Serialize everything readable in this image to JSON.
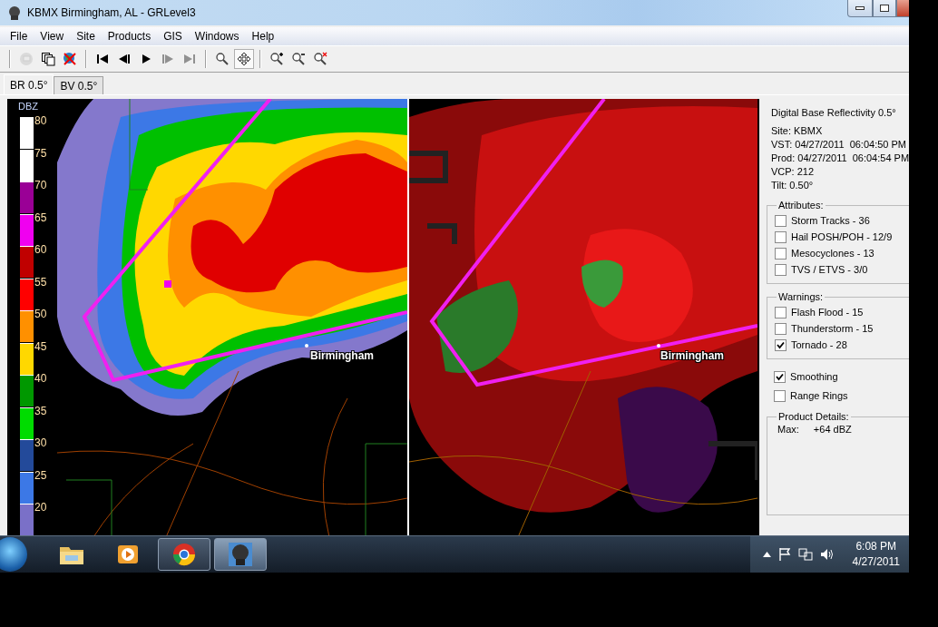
{
  "window": {
    "title": "KBMX Birmingham, AL - GRLevel3"
  },
  "menu": [
    "File",
    "View",
    "Site",
    "Products",
    "GIS",
    "Windows",
    "Help"
  ],
  "toolbar": [
    [
      {
        "kind": "site",
        "disabled": true,
        "selected": false
      },
      {
        "kind": "windows",
        "disabled": false,
        "selected": false
      },
      {
        "kind": "disconnect",
        "disabled": false,
        "selected": false
      }
    ],
    [
      {
        "kind": "first",
        "disabled": false,
        "selected": false
      },
      {
        "kind": "previous",
        "disabled": false,
        "selected": false
      },
      {
        "kind": "play",
        "disabled": false,
        "selected": false
      },
      {
        "kind": "next",
        "disabled": true,
        "selected": false
      },
      {
        "kind": "last",
        "disabled": true,
        "selected": false
      }
    ],
    [
      {
        "kind": "zoom",
        "disabled": false,
        "selected": false
      },
      {
        "kind": "pan",
        "disabled": false,
        "selected": true
      }
    ],
    [
      {
        "kind": "zoom-in",
        "disabled": false,
        "selected": false
      },
      {
        "kind": "zoom-out",
        "disabled": false,
        "selected": false
      },
      {
        "kind": "zoom-reset",
        "disabled": false,
        "selected": false
      }
    ]
  ],
  "tabs": [
    {
      "label": "BR 0.5°",
      "selected": true
    },
    {
      "label": "BV 0.5°",
      "selected": false
    }
  ],
  "legend": {
    "title": "DBZ",
    "levels": [
      {
        "label": "80",
        "color": "#ffffff"
      },
      {
        "label": "75",
        "color": "#ffffff"
      },
      {
        "label": "70",
        "color": "#9a0096"
      },
      {
        "label": "65",
        "color": "#f000f0"
      },
      {
        "label": "60",
        "color": "#c00000"
      },
      {
        "label": "55",
        "color": "#ff0000"
      },
      {
        "label": "50",
        "color": "#ff9000"
      },
      {
        "label": "45",
        "color": "#ffd800"
      },
      {
        "label": "40",
        "color": "#009800"
      },
      {
        "label": "35",
        "color": "#00dc00"
      },
      {
        "label": "30",
        "color": "#234a9a"
      },
      {
        "label": "25",
        "color": "#3c78e6"
      },
      {
        "label": "20",
        "color": "#7a70c8"
      }
    ]
  },
  "maps": [
    {
      "kind": "reflectivity",
      "city": "Birmingham"
    },
    {
      "kind": "velocity",
      "city": "Birmingham"
    }
  ],
  "product": {
    "title": "Digital Base Reflectivity 0.5°",
    "fields": [
      {
        "label": "Site:",
        "value": "KBMX"
      },
      {
        "label": "VST:",
        "value": "04/27/2011  06:04:50 PM"
      },
      {
        "label": "Prod:",
        "value": "04/27/2011  06:04:54 PM"
      },
      {
        "label": "VCP:",
        "value": "212"
      },
      {
        "label": "Tilt:",
        "value": "0.50°"
      }
    ]
  },
  "attributes": {
    "title": "Attributes:",
    "items": [
      {
        "label": "Storm Tracks - 36",
        "checked": false
      },
      {
        "label": "Hail POSH/POH - 12/9",
        "checked": false
      },
      {
        "label": "Mesocyclones - 13",
        "checked": false
      },
      {
        "label": "TVS / ETVS - 3/0",
        "checked": false
      }
    ]
  },
  "warnings": {
    "title": "Warnings:",
    "items": [
      {
        "label": "Flash Flood - 15",
        "checked": false
      },
      {
        "label": "Thunderstorm - 15",
        "checked": false
      },
      {
        "label": "Tornado - 28",
        "checked": true
      }
    ]
  },
  "options": [
    {
      "label": "Smoothing",
      "checked": true
    },
    {
      "label": "Range Rings",
      "checked": false
    }
  ],
  "details": {
    "title": "Product Details:",
    "rows": [
      {
        "label": "Max:",
        "value": "+64 dBZ"
      }
    ]
  },
  "taskbar": {
    "apps": [
      {
        "kind": "folder",
        "running": false,
        "selected": false
      },
      {
        "kind": "media",
        "running": false,
        "selected": false
      },
      {
        "kind": "browser",
        "running": true,
        "selected": false
      },
      {
        "kind": "radar",
        "running": true,
        "selected": true
      }
    ],
    "time": "6:08 PM",
    "date": "4/27/2011"
  }
}
